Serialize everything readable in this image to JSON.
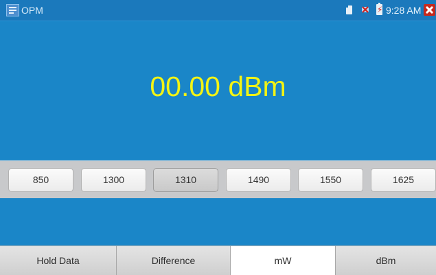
{
  "statusbar": {
    "app_title": "OPM",
    "time": "9:28 AM",
    "icons": [
      "sd-card-icon",
      "network-icon",
      "battery-charging-icon",
      "close-icon"
    ]
  },
  "reading": {
    "value": "00.00 dBm"
  },
  "wavelengths": {
    "items": [
      "850",
      "1300",
      "1310",
      "1490",
      "1550",
      "1625"
    ],
    "selected": "1310"
  },
  "tabs": {
    "items": [
      "Hold Data",
      "Difference",
      "mW",
      "dBm"
    ],
    "active": "mW"
  },
  "colors": {
    "background": "#1a86c8",
    "reading": "#f3f414",
    "close": "#c62a1e"
  }
}
